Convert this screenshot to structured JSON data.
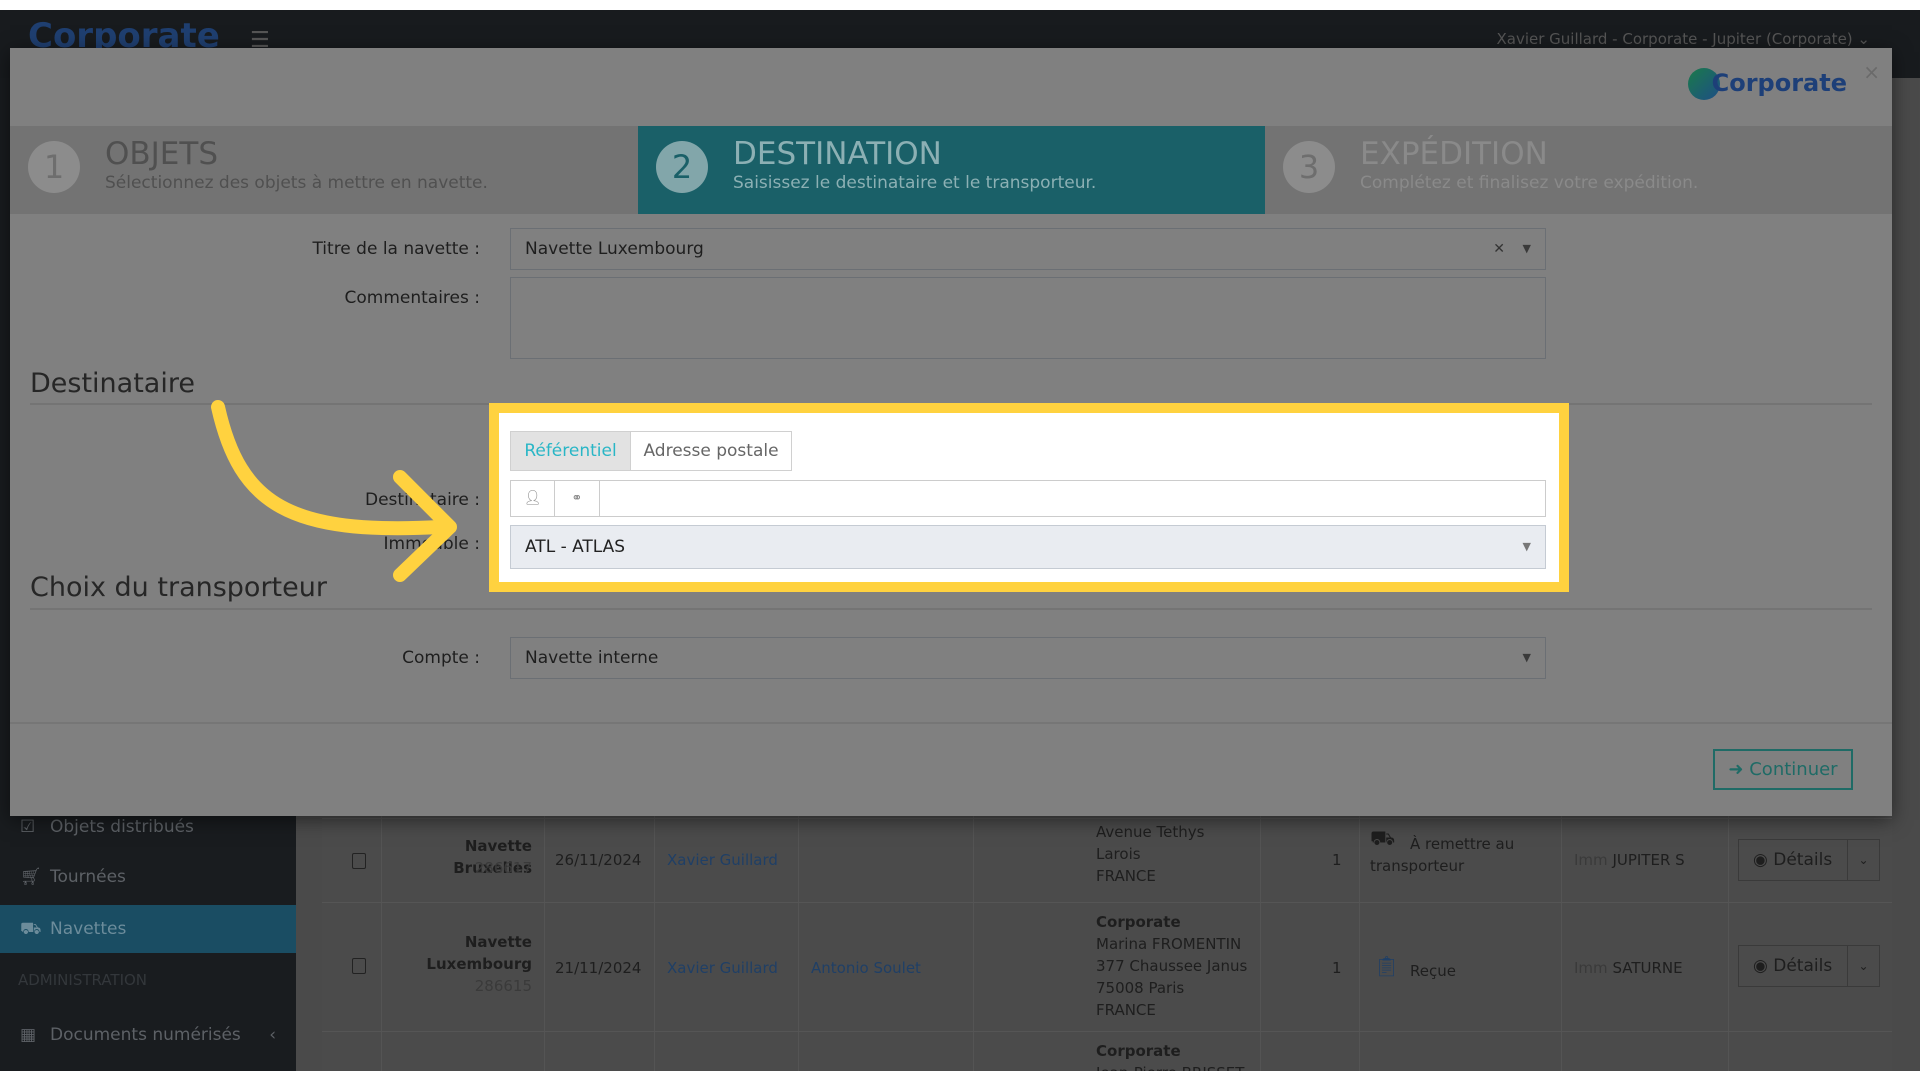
{
  "header": {
    "logo": "Corporate",
    "user": "Xavier Guillard - Corporate - Jupiter (Corporate)"
  },
  "sidebar": {
    "items": [
      {
        "label": "Objets distribués",
        "icon": "check-square-icon"
      },
      {
        "label": "Tournées",
        "icon": "cart-icon"
      },
      {
        "label": "Navettes",
        "icon": "truck-icon",
        "active": true
      }
    ],
    "section": "ADMINISTRATION",
    "docs": {
      "label": "Documents numérisés",
      "icon": "grid-icon"
    }
  },
  "table": {
    "rows": [
      {
        "title": "Navette Bruxelles",
        "id": "286617",
        "date": "26/11/2024",
        "sender": "Xavier Guillard",
        "recipient": "",
        "address": [
          "Avenue Tethys",
          "Larois",
          "FRANCE"
        ],
        "address_org": "",
        "qty": "1",
        "status": "À remettre au transporteur",
        "status_icon": "truck-hourglass-icon",
        "building_prefix": "Imm",
        "building": "JUPITER S",
        "details": "Détails"
      },
      {
        "title": "Navette Luxembourg",
        "id": "286615",
        "date": "21/11/2024",
        "sender": "Xavier Guillard",
        "recipient": "Antonio Soulet",
        "address_org": "Corporate",
        "address": [
          "Marina FROMENTIN",
          "377 Chaussee Janus",
          "75008 Paris",
          "FRANCE"
        ],
        "qty": "1",
        "status": "Reçue",
        "status_icon": "clipboard-check-icon",
        "building_prefix": "Imm",
        "building": "SATURNE",
        "details": "Détails"
      },
      {
        "address_org": "Corporate",
        "address": [
          "Jean-Pierre BRISSET"
        ]
      }
    ]
  },
  "modal": {
    "logo": "Corporate",
    "close": "×",
    "steps": [
      {
        "num": "1",
        "title": "OBJETS",
        "subtitle": "Sélectionnez des objets à mettre en navette."
      },
      {
        "num": "2",
        "title": "DESTINATION",
        "subtitle": "Saisissez le destinataire et le transporteur."
      },
      {
        "num": "3",
        "title": "EXPÉDITION",
        "subtitle": "Complétez et finalisez votre expédition."
      }
    ],
    "form": {
      "title_label": "Titre de la navette :",
      "title_value": "Navette Luxembourg",
      "comments_label": "Commentaires :",
      "comments_value": "",
      "dest_heading": "Destinataire",
      "tabs": [
        "Référentiel",
        "Adresse postale"
      ],
      "dest_label": "Destinataire :",
      "dest_value": "",
      "building_label": "Immeuble :",
      "building_value": "ATL - ATLAS",
      "carrier_heading": "Choix du transporteur",
      "account_label": "Compte :",
      "account_value": "Navette interne"
    },
    "continue": "Continuer"
  },
  "colors": {
    "accent": "#1a6068",
    "highlight": "#ffd23f",
    "tab_active": "#29b6c6"
  }
}
